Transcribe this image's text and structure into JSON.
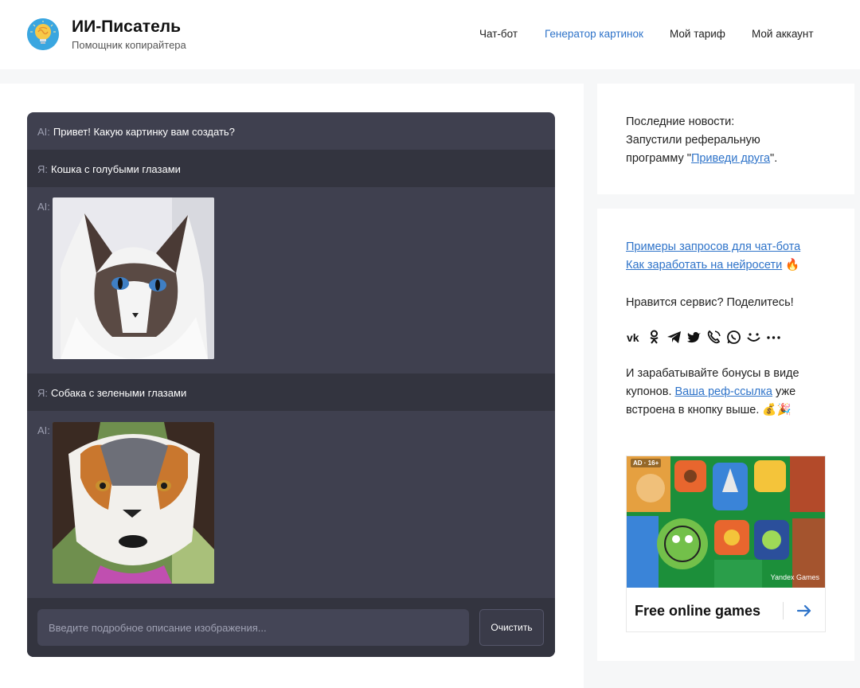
{
  "header": {
    "title": "ИИ-Писатель",
    "subtitle": "Помощник копирайтера",
    "nav": [
      {
        "label": "Чат-бот",
        "active": false
      },
      {
        "label": "Генератор картинок",
        "active": true
      },
      {
        "label": "Мой тариф",
        "active": false
      },
      {
        "label": "Мой аккаунт",
        "active": false
      }
    ]
  },
  "chat": {
    "ai_prefix": "AI:",
    "user_prefix": "Я:",
    "greeting": "Привет! Какую картинку вам создать?",
    "request_1": "Кошка с голубыми глазами",
    "request_2": "Собака с зелеными глазами",
    "input_placeholder": "Введите подробное описание изображения...",
    "clear_label": "Очистить"
  },
  "news": {
    "line1": "Последние новости:",
    "line2": "Запустили реферальную",
    "line3_before": "программу \"",
    "line3_link": "Приведи друга",
    "line3_after": "\"."
  },
  "promo": {
    "link1": "Примеры запросов для чат-бота",
    "link2": "Как заработать на нейросети",
    "link2_emoji": "🔥",
    "share_title": "Нравится сервис? Поделитесь!",
    "share_icons": [
      "vk-icon",
      "odnoklassniki-icon",
      "telegram-icon",
      "twitter-icon",
      "viber-icon",
      "whatsapp-icon",
      "moymir-icon",
      "more-icon"
    ],
    "bonus_line1": "И зарабатывайте бонусы в виде",
    "bonus_line2_before": "купонов. ",
    "bonus_line2_link": "Ваша реф-ссылка",
    "bonus_line2_after": " уже",
    "bonus_line3": "встроена в кнопку выше. 💰🎉"
  },
  "ad": {
    "badge": "AD · 16+",
    "brand": "Yandex Games",
    "title": "Free online games",
    "arrow": "→",
    "colors": {
      "accent": "#2e73c9",
      "ad_green": "#1c8f3a"
    }
  },
  "colors": {
    "chat_bg": "#3f404f",
    "chat_user_bg": "#33343f",
    "link": "#2e73c9",
    "nav_active": "#2e73c9"
  }
}
